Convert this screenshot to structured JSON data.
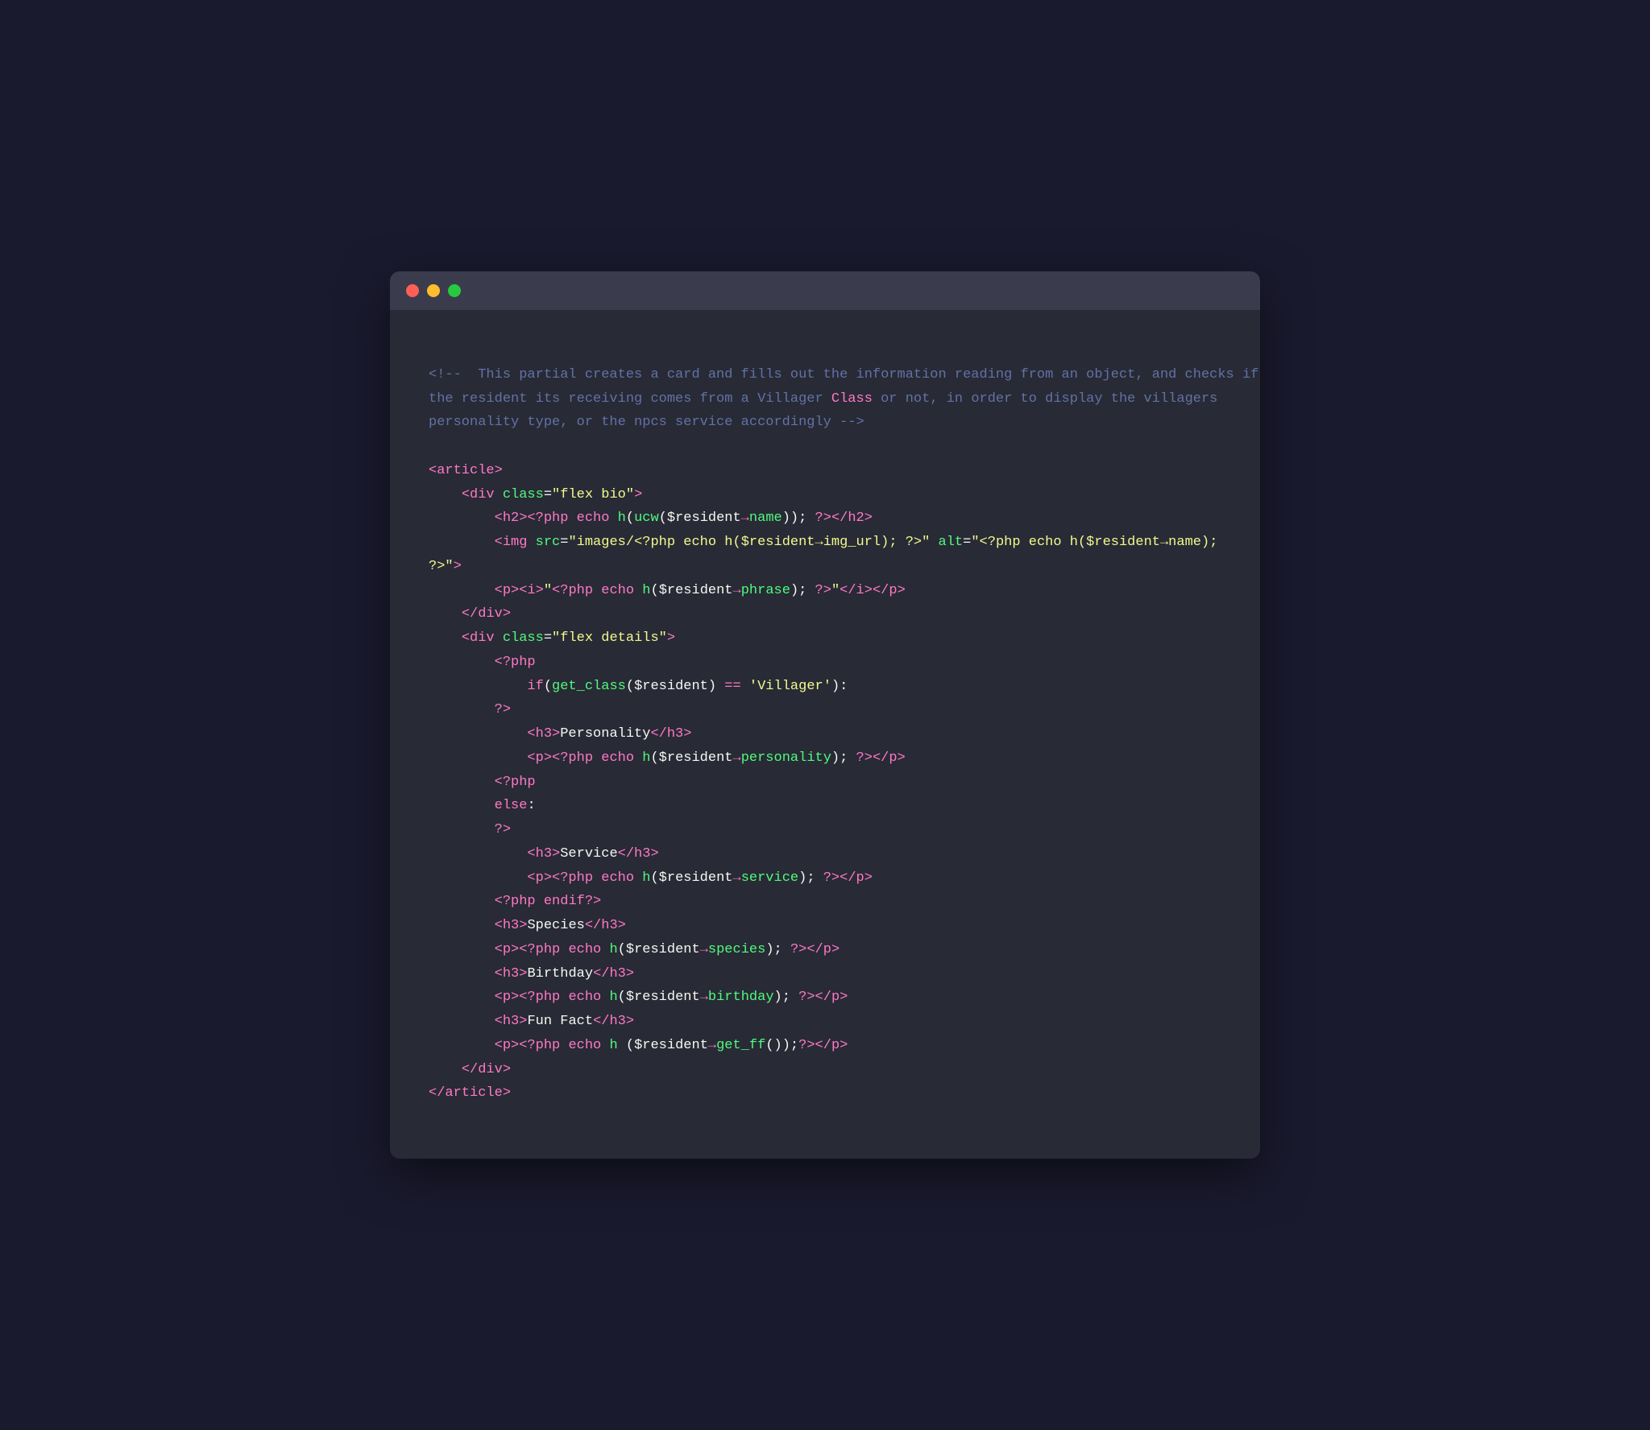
{
  "window": {
    "dots": [
      "red",
      "yellow",
      "green"
    ],
    "dot_labels": [
      "close",
      "minimize",
      "maximize"
    ]
  },
  "code": {
    "comment_line1": "<!--  This partial creates a card and fills out the information reading from an object, and checks if",
    "comment_line2": "the resident its receiving comes from a Villager Class or not, in order to display the villagers",
    "comment_line3": "personality type, or the npcs service accordingly -->",
    "blank1": "",
    "article_open": "<article>",
    "div_bio_open": "    <div class=\"flex bio\">",
    "h2_line": "        <h2><?php echo h(ucw($resident→name)); ?></h2>",
    "img_line": "        <img src=\"images/<?php echo h($resident→img_url); ?>\" alt=\"<?php echo h($resident→name);",
    "img_close": "?>\">",
    "p_phrase": "        <p><i>\"<?php echo h($resident→phrase); ?>\"</i></p>",
    "div_bio_close": "    </div>",
    "div_details_open": "    <div class=\"flex details\">",
    "php_open1": "        <?php",
    "if_line": "            if(get_class($resident) == 'Villager'):",
    "php_close1": "        ?>",
    "h3_personality": "            <h3>Personality</h3>",
    "p_personality": "            <p><?php echo h($resident→personality); ?></p>",
    "php_open2": "        <?php",
    "else_line": "        else:",
    "php_close2": "        ?>",
    "h3_service": "            <h3>Service</h3>",
    "p_service": "            <p><?php echo h($resident→service); ?></p>",
    "php_endif": "        <?php endif?>",
    "h3_species": "        <h3>Species</h3>",
    "p_species": "        <p><?php echo h($resident→species); ?></p>",
    "h3_birthday": "        <h3>Birthday</h3>",
    "p_birthday": "        <p><?php echo h($resident→birthday); ?></p>",
    "h3_funfact": "        <h3>Fun Fact</h3>",
    "p_funfact": "        <p><?php echo h ($resident→get_ff());?></p>",
    "div_details_close": "    </div>",
    "article_close": "</article>"
  }
}
